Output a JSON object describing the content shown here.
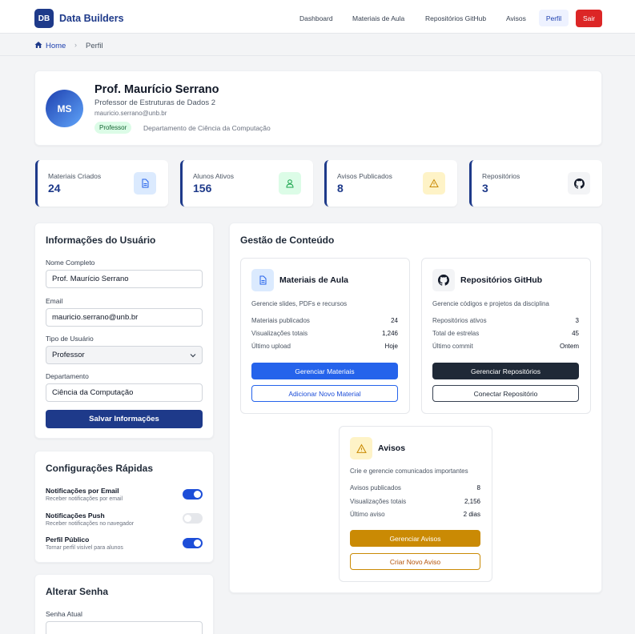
{
  "header": {
    "logo_text": "DB",
    "brand": "Data Builders",
    "nav": [
      "Dashboard",
      "Materiais de Aula",
      "Repositórios GitHub",
      "Avisos"
    ],
    "active": "Perfil",
    "logout": "Sair"
  },
  "breadcrumb": {
    "home": "Home",
    "current": "Perfil"
  },
  "profile": {
    "initials": "MS",
    "name": "Prof. Maurício Serrano",
    "role": "Professor de Estruturas de Dados 2",
    "email": "mauricio.serrano@unb.br",
    "badge": "Professor",
    "department": "Departamento de Ciência da Computação"
  },
  "stats": [
    {
      "label": "Materiais Criados",
      "value": "24",
      "icon": "document-icon"
    },
    {
      "label": "Alunos Ativos",
      "value": "156",
      "icon": "user-icon"
    },
    {
      "label": "Avisos Publicados",
      "value": "8",
      "icon": "warning-icon"
    },
    {
      "label": "Repositórios",
      "value": "3",
      "icon": "github-icon"
    }
  ],
  "user_info": {
    "title": "Informações do Usuário",
    "name_label": "Nome Completo",
    "name_value": "Prof. Maurício Serrano",
    "email_label": "Email",
    "email_value": "mauricio.serrano@unb.br",
    "type_label": "Tipo de Usuário",
    "type_value": "Professor",
    "dept_label": "Departamento",
    "dept_value": "Ciência da Computação",
    "save": "Salvar Informações"
  },
  "quick_settings": {
    "title": "Configurações Rápidas",
    "items": [
      {
        "label": "Notificações por Email",
        "sub": "Receber notificações por email",
        "on": true
      },
      {
        "label": "Notificações Push",
        "sub": "Receber notificações no navegador",
        "on": false
      },
      {
        "label": "Perfil Público",
        "sub": "Tornar perfil visível para alunos",
        "on": true
      }
    ]
  },
  "password": {
    "title": "Alterar Senha",
    "current_label": "Senha Atual"
  },
  "content": {
    "title": "Gestão de Conteúdo",
    "materials": {
      "title": "Materiais de Aula",
      "desc": "Gerencie slides, PDFs e recursos",
      "rows": [
        [
          "Materiais publicados",
          "24"
        ],
        [
          "Visualizações totais",
          "1,246"
        ],
        [
          "Último upload",
          "Hoje"
        ]
      ],
      "primary": "Gerenciar Materiais",
      "secondary": "Adicionar Novo Material"
    },
    "repos": {
      "title": "Repositórios GitHub",
      "desc": "Gerencie códigos e projetos da disciplina",
      "rows": [
        [
          "Repositórios ativos",
          "3"
        ],
        [
          "Total de estrelas",
          "45"
        ],
        [
          "Último commit",
          "Ontem"
        ]
      ],
      "primary": "Gerenciar Repositórios",
      "secondary": "Conectar Repositório"
    },
    "notices": {
      "title": "Avisos",
      "desc": "Crie e gerencie comunicados importantes",
      "rows": [
        [
          "Avisos publicados",
          "8"
        ],
        [
          "Visualizações totais",
          "2,156"
        ],
        [
          "Último aviso",
          "2 dias"
        ]
      ],
      "primary": "Gerenciar Avisos",
      "secondary": "Criar Novo Aviso"
    }
  },
  "colors": {
    "primary": "#1e3a8a",
    "accent": "#1d4ed8",
    "danger": "#dc2626",
    "warning": "#ca8a04",
    "dark": "#1f2937"
  }
}
